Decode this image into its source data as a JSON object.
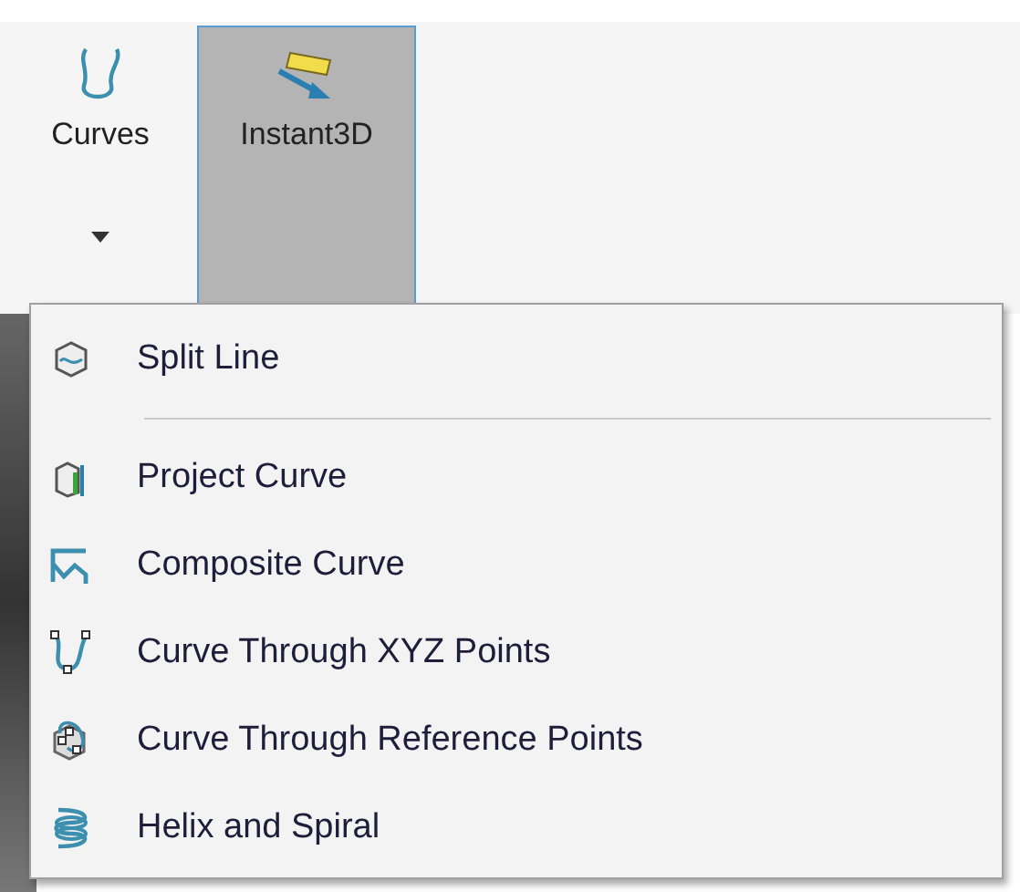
{
  "ribbon": {
    "buttons": [
      {
        "label": "Curves",
        "selected": false,
        "has_dropdown": true
      },
      {
        "label": "Instant3D",
        "selected": true,
        "has_dropdown": false
      }
    ]
  },
  "menu": {
    "items": [
      {
        "kind": "item",
        "label": "Split Line"
      },
      {
        "kind": "separator"
      },
      {
        "kind": "item",
        "label": "Project Curve"
      },
      {
        "kind": "item",
        "label": "Composite Curve"
      },
      {
        "kind": "item",
        "label": "Curve Through XYZ Points"
      },
      {
        "kind": "item",
        "label": "Curve Through Reference Points"
      },
      {
        "kind": "item",
        "label": "Helix and Spiral"
      }
    ]
  }
}
